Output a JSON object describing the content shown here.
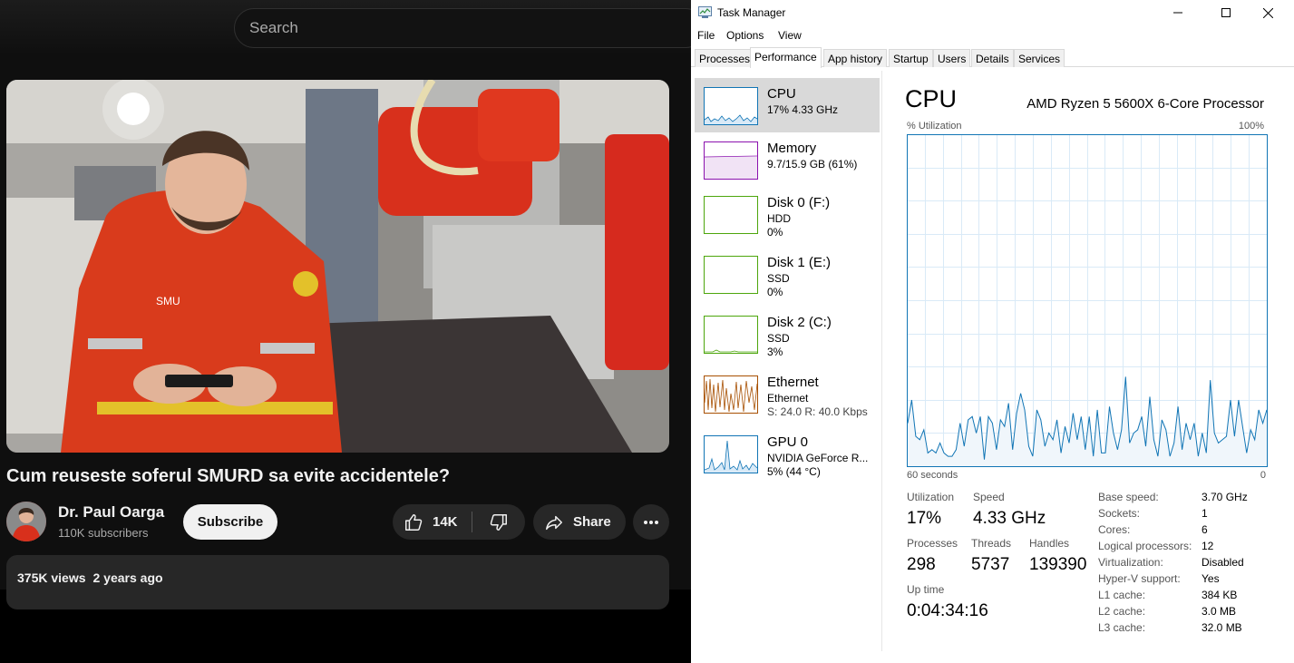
{
  "youtube": {
    "search": {
      "placeholder": "Search"
    },
    "video": {
      "title": "Cum reuseste soferul SMURD sa evite accidentele?",
      "channel": "Dr. Paul Oarga",
      "subscribers": "110K subscribers",
      "subscribe_label": "Subscribe",
      "like_count": "14K",
      "share_label": "Share",
      "views": "375K views",
      "published": "2 years ago"
    },
    "colors": {
      "background": "#0f0f0f",
      "chip": "#272727",
      "text": "#f1f1f1",
      "muted": "#aaaaaa"
    }
  },
  "task_manager": {
    "window_title": "Task Manager",
    "menu": [
      "File",
      "Options",
      "View"
    ],
    "tabs": [
      "Processes",
      "Performance",
      "App history",
      "Startup",
      "Users",
      "Details",
      "Services"
    ],
    "active_tab": "Performance",
    "resources": [
      {
        "name": "CPU",
        "line1": "17% 4.33 GHz",
        "selected": true,
        "color": "#1175b5"
      },
      {
        "name": "Memory",
        "line1": "9.7/15.9 GB (61%)",
        "color": "#8b12ae"
      },
      {
        "name": "Disk 0 (F:)",
        "line1": "HDD",
        "line2": "0%",
        "color": "#4da60c"
      },
      {
        "name": "Disk 1 (E:)",
        "line1": "SSD",
        "line2": "0%",
        "color": "#4da60c"
      },
      {
        "name": "Disk 2 (C:)",
        "line1": "SSD",
        "line2": "3%",
        "color": "#4da60c"
      },
      {
        "name": "Ethernet",
        "line1": "Ethernet",
        "line2": "S: 24.0  R: 40.0 Kbps",
        "color": "#a74f01"
      },
      {
        "name": "GPU 0",
        "line1": "NVIDIA GeForce R...",
        "line2": "5% (44 °C)",
        "color": "#1175b5"
      }
    ],
    "detail": {
      "heading": "CPU",
      "processor": "AMD Ryzen 5 5600X 6-Core Processor",
      "util_label": "% Utilization",
      "util_max": "100%",
      "time_left": "60 seconds",
      "time_right": "0",
      "stats": {
        "utilization_label": "Utilization",
        "utilization": "17%",
        "speed_label": "Speed",
        "speed": "4.33 GHz",
        "processes_label": "Processes",
        "processes": "298",
        "threads_label": "Threads",
        "threads": "5737",
        "handles_label": "Handles",
        "handles": "139390",
        "uptime_label": "Up time",
        "uptime": "0:04:34:16"
      },
      "specs": [
        {
          "label": "Base speed:",
          "value": "3.70 GHz"
        },
        {
          "label": "Sockets:",
          "value": "1"
        },
        {
          "label": "Cores:",
          "value": "6"
        },
        {
          "label": "Logical processors:",
          "value": "12"
        },
        {
          "label": "Virtualization:",
          "value": "Disabled"
        },
        {
          "label": "Hyper-V support:",
          "value": "Yes"
        },
        {
          "label": "L1 cache:",
          "value": "384 KB"
        },
        {
          "label": "L2 cache:",
          "value": "3.0 MB"
        },
        {
          "label": "L3 cache:",
          "value": "32.0 MB"
        }
      ],
      "cpu_history": [
        13,
        20,
        9,
        8,
        11,
        4,
        5,
        4,
        7,
        4,
        3,
        3,
        5,
        13,
        6,
        14,
        15,
        10,
        15,
        2,
        15,
        13,
        5,
        14,
        12,
        19,
        5,
        16,
        22,
        17,
        6,
        3,
        17,
        14,
        6,
        10,
        8,
        14,
        4,
        12,
        7,
        16,
        8,
        15,
        5,
        15,
        3,
        17,
        4,
        4,
        18,
        10,
        5,
        11,
        27,
        7,
        10,
        11,
        15,
        6,
        21,
        8,
        3,
        14,
        11,
        3,
        7,
        18,
        5,
        13,
        8,
        13,
        3,
        10,
        4,
        26,
        10,
        7,
        8,
        9,
        20,
        9,
        20,
        12,
        4,
        11,
        8,
        17,
        13,
        17
      ]
    }
  }
}
